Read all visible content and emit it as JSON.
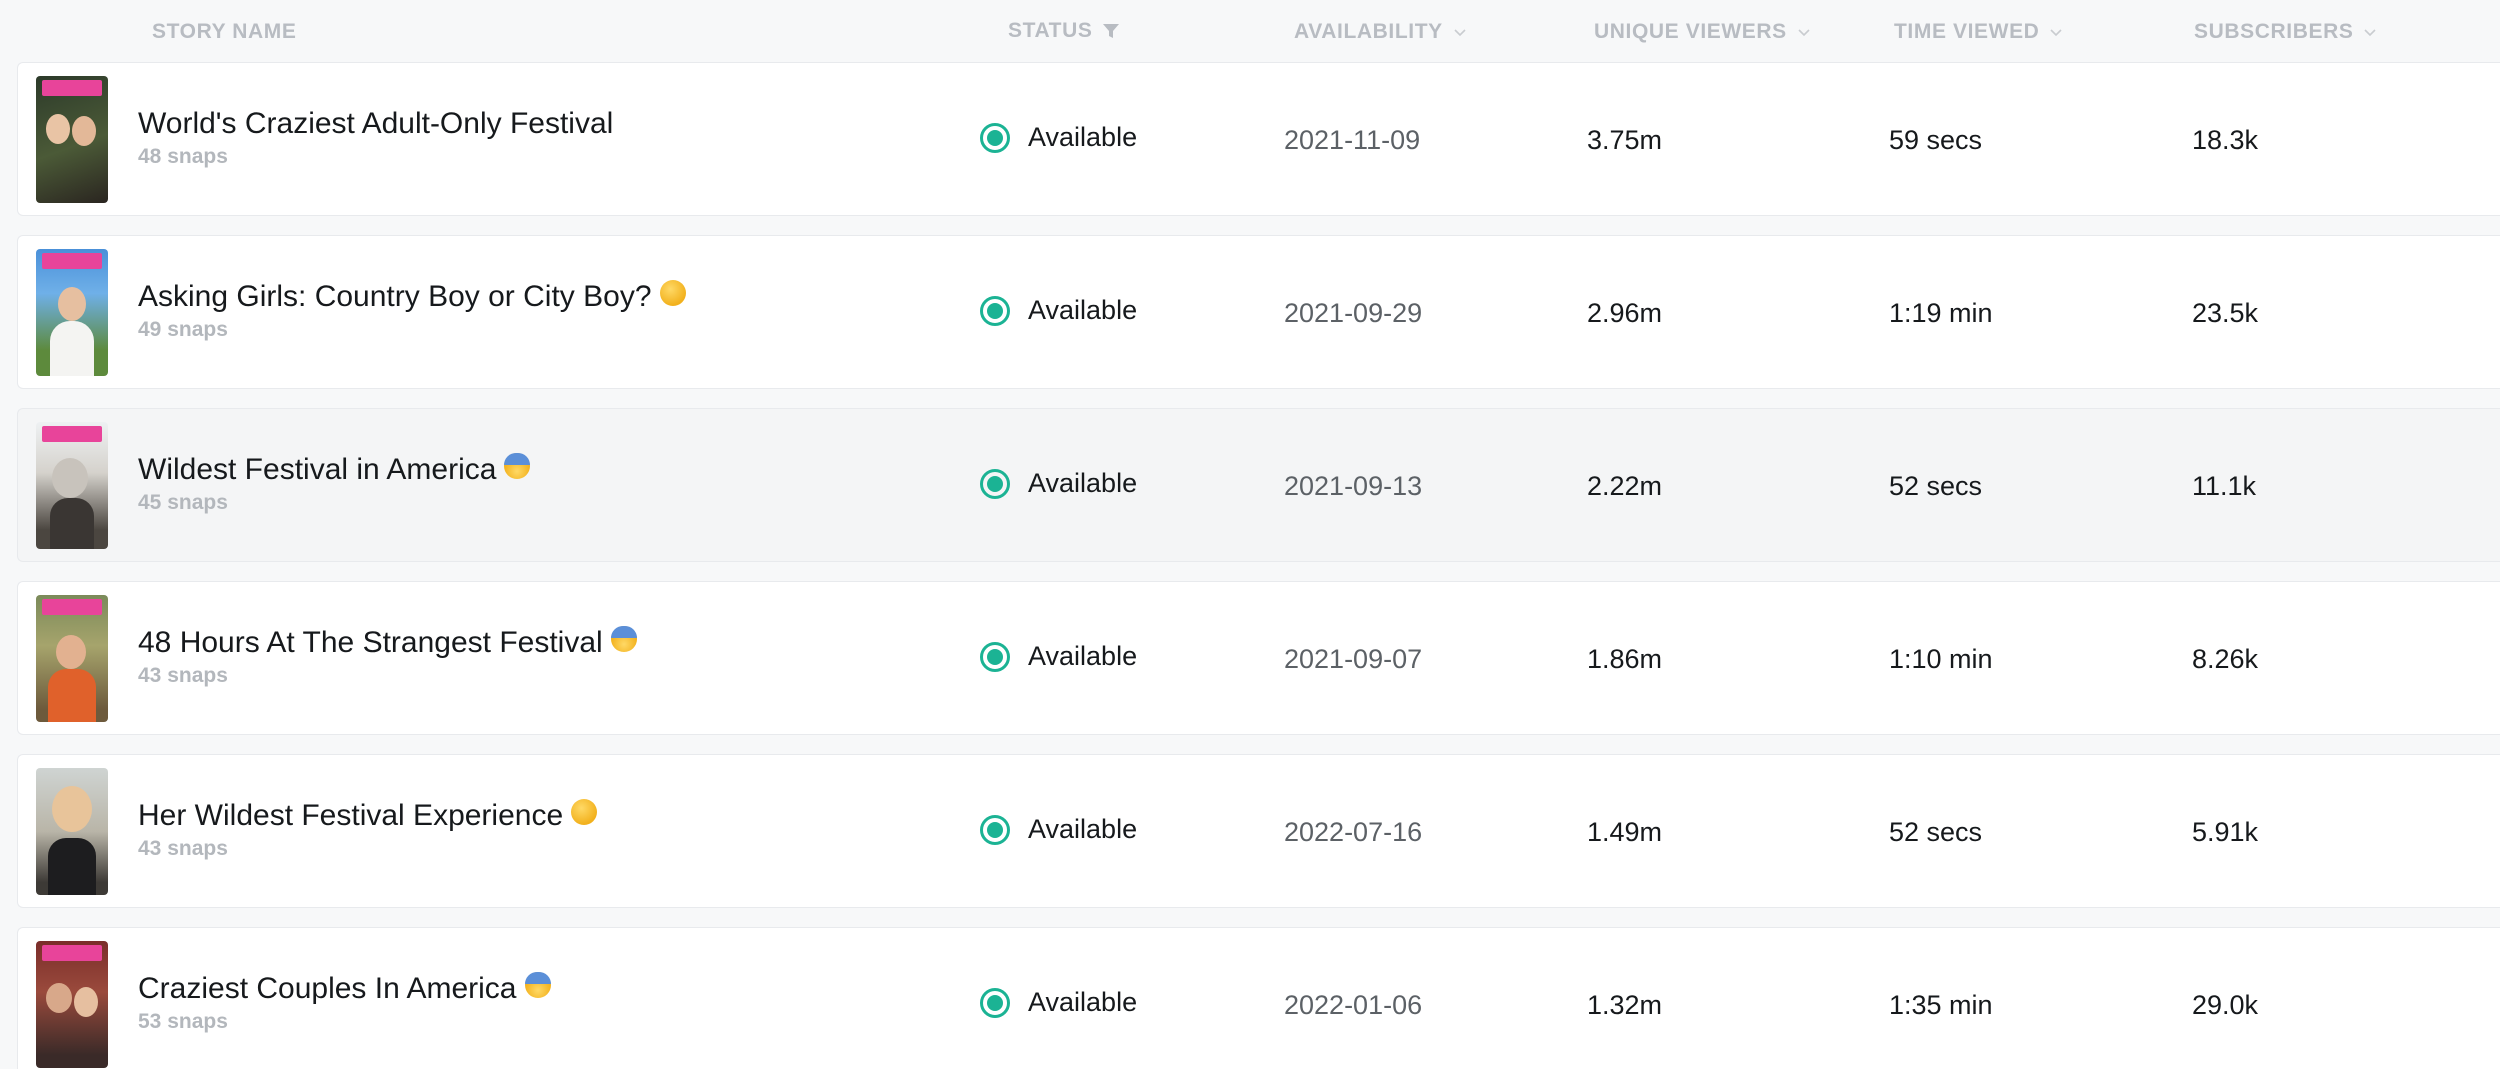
{
  "header": {
    "story_name": "STORY NAME",
    "status": "STATUS",
    "availability": "AVAILABILITY",
    "unique_viewers": "UNIQUE VIEWERS",
    "time_viewed": "TIME VIEWED",
    "subscribers": "SUBSCRIBERS"
  },
  "colors": {
    "status_green": "#1bb394",
    "header_text": "#b8bcc2"
  },
  "rows": [
    {
      "title": "World's Craziest Adult-Only Festival",
      "emoji": "",
      "snaps": "48 snaps",
      "status": "Available",
      "availability": "2021-11-09",
      "unique_viewers": "3.75m",
      "time_viewed": "59 secs",
      "subscribers": "18.3k"
    },
    {
      "title": "Asking Girls: Country Boy or City Boy?",
      "emoji": "raised-eyebrow-emoji",
      "snaps": "49 snaps",
      "status": "Available",
      "availability": "2021-09-29",
      "unique_viewers": "2.96m",
      "time_viewed": "1:19 min",
      "subscribers": "23.5k"
    },
    {
      "title": "Wildest Festival in America",
      "emoji": "fearful-face-emoji",
      "snaps": "45 snaps",
      "status": "Available",
      "availability": "2021-09-13",
      "unique_viewers": "2.22m",
      "time_viewed": "52 secs",
      "subscribers": "11.1k"
    },
    {
      "title": "48 Hours At The Strangest Festival",
      "emoji": "fearful-face-emoji",
      "snaps": "43 snaps",
      "status": "Available",
      "availability": "2021-09-07",
      "unique_viewers": "1.86m",
      "time_viewed": "1:10 min",
      "subscribers": "8.26k"
    },
    {
      "title": "Her Wildest Festival Experience",
      "emoji": "shushing-face-emoji",
      "snaps": "43 snaps",
      "status": "Available",
      "availability": "2022-07-16",
      "unique_viewers": "1.49m",
      "time_viewed": "52 secs",
      "subscribers": "5.91k"
    },
    {
      "title": "Craziest Couples In America",
      "emoji": "fearful-face-emoji",
      "snaps": "53 snaps",
      "status": "Available",
      "availability": "2022-01-06",
      "unique_viewers": "1.32m",
      "time_viewed": "1:35 min",
      "subscribers": "29.0k"
    }
  ]
}
